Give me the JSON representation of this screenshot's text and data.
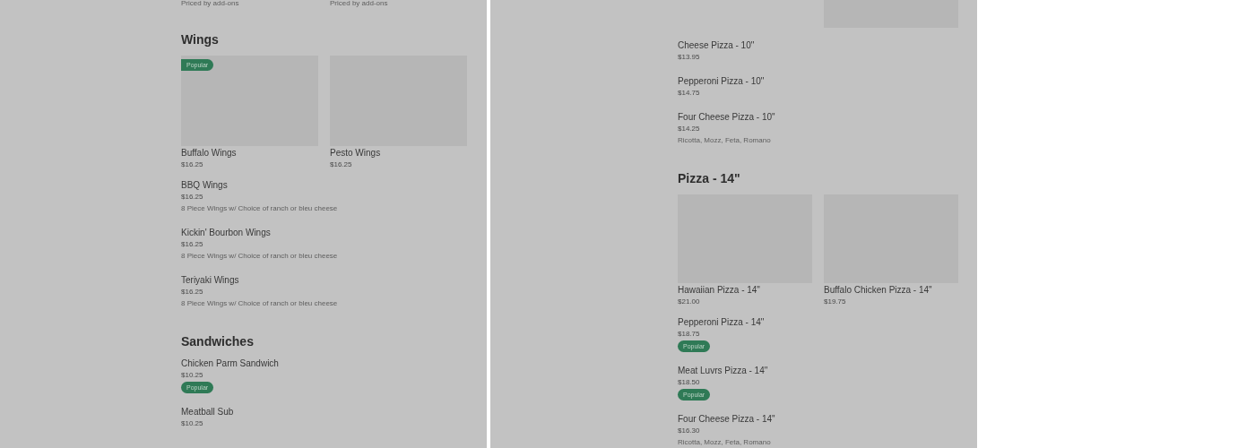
{
  "panels": [
    {
      "blocks": [
        {
          "kind": "text_grid",
          "items": [
            {
              "description": "Priced by add-ons"
            },
            {
              "description": "Priced by add-ons"
            }
          ]
        },
        {
          "kind": "heading",
          "text": "Wings"
        },
        {
          "kind": "card_row",
          "items": [
            {
              "badge": "Popular",
              "name": "Buffalo Wings",
              "price": "$16.25"
            },
            {
              "name": "Pesto Wings",
              "price": "$16.25"
            }
          ]
        },
        {
          "kind": "item",
          "name": "BBQ Wings",
          "price": "$16.25",
          "description": "8 Piece Wings w/ Choice of ranch or bleu cheese"
        },
        {
          "kind": "item",
          "name": "Kickin' Bourbon Wings",
          "price": "$16.25",
          "description": "8 Piece Wings w/ Choice of ranch or bleu cheese"
        },
        {
          "kind": "item",
          "name": "Teriyaki Wings",
          "price": "$16.25",
          "description": "8 Piece Wings w/ Choice of ranch or bleu cheese"
        },
        {
          "kind": "heading",
          "text": "Sandwiches"
        },
        {
          "kind": "item",
          "name": "Chicken Parm Sandwich",
          "price": "$10.25",
          "badge": "Popular"
        },
        {
          "kind": "item",
          "name": "Meatball Sub",
          "price": "$10.25"
        }
      ]
    },
    {
      "blocks": [
        {
          "kind": "image_strip"
        },
        {
          "kind": "item",
          "name": "Cheese Pizza - 10\"",
          "price": "$13.95"
        },
        {
          "kind": "item",
          "name": "Pepperoni Pizza - 10\"",
          "price": "$14.75"
        },
        {
          "kind": "item",
          "name": "Four Cheese Pizza - 10\"",
          "price": "$14.25",
          "description": "Ricotta, Mozz, Feta, Romano"
        },
        {
          "kind": "heading",
          "text": "Pizza - 14\""
        },
        {
          "kind": "card_row",
          "items": [
            {
              "name": "Hawaiian Pizza - 14\"",
              "price": "$21.00"
            },
            {
              "name": "Buffalo Chicken Pizza - 14\"",
              "price": "$19.75"
            }
          ]
        },
        {
          "kind": "item",
          "name": "Pepperoni Pizza - 14\"",
          "price": "$18.75",
          "badge": "Popular"
        },
        {
          "kind": "item",
          "name": "Meat Luvrs Pizza - 14\"",
          "price": "$18.50",
          "badge": "Popular"
        },
        {
          "kind": "item",
          "name": "Four Cheese Pizza - 14\"",
          "price": "$16.30",
          "description": "Ricotta, Mozz, Feta, Romano"
        }
      ]
    }
  ]
}
